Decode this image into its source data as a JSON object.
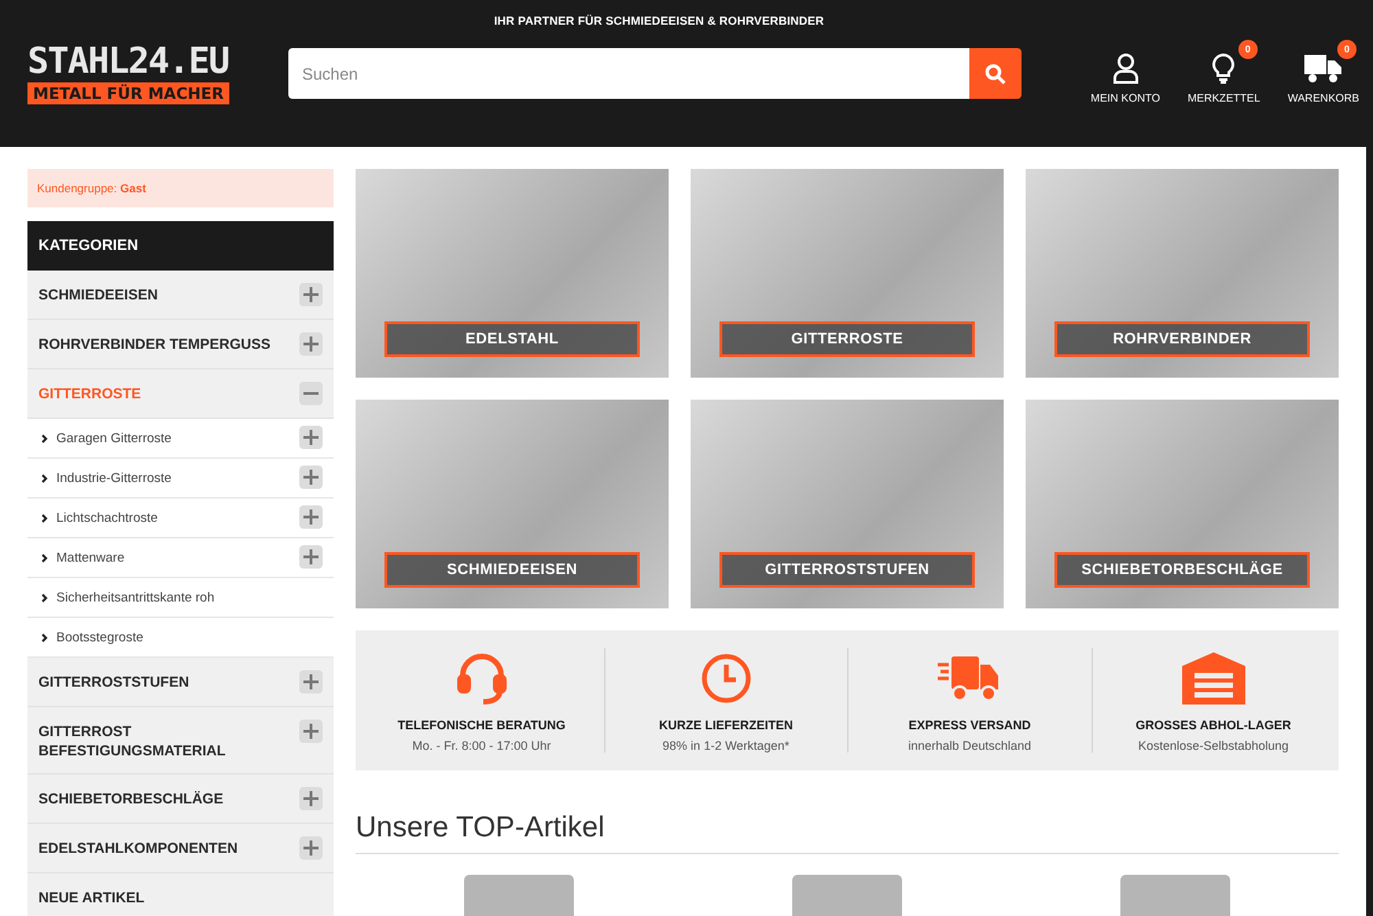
{
  "header": {
    "tagline": "IHR PARTNER FÜR SCHMIEDEEISEN & ROHRVERBINDER",
    "logo": {
      "name": "STAHL24.EU",
      "slogan": "METALL FÜR MACHER"
    },
    "search": {
      "placeholder": "Suchen"
    },
    "actions": [
      {
        "kind": "account",
        "label": "MEIN KONTO"
      },
      {
        "kind": "wishlist",
        "label": "MERKZETTEL",
        "badge": "0"
      },
      {
        "kind": "cart",
        "label": "WARENKORB",
        "badge": "0"
      }
    ]
  },
  "sidebar": {
    "customer_group": {
      "label": "Kundengruppe:",
      "value": "Gast"
    },
    "title": "KATEGORIEN",
    "items": [
      {
        "label": "SCHMIEDEEISEN",
        "expandable": true,
        "expanded": false,
        "selected": false
      },
      {
        "label": "ROHRVERBINDER TEMPERGUSS",
        "expandable": true,
        "expanded": false,
        "selected": false
      },
      {
        "label": "GITTERROSTE",
        "expandable": true,
        "expanded": true,
        "selected": true,
        "children": [
          {
            "label": "Garagen Gitterroste",
            "expandable": true
          },
          {
            "label": "Industrie-Gitterroste",
            "expandable": true
          },
          {
            "label": "Lichtschachtroste",
            "expandable": true
          },
          {
            "label": "Mattenware",
            "expandable": true
          },
          {
            "label": "Sicherheitsantrittskante roh",
            "expandable": false
          },
          {
            "label": "Bootsstegroste",
            "expandable": false
          }
        ]
      },
      {
        "label": "GITTERROSTSTUFEN",
        "expandable": true,
        "expanded": false,
        "selected": false
      },
      {
        "label": "GITTERROST BEFESTIGUNGSMATERIAL",
        "expandable": true,
        "expanded": false,
        "selected": false
      },
      {
        "label": "SCHIEBETORBESCHLÄGE",
        "expandable": true,
        "expanded": false,
        "selected": false
      },
      {
        "label": "EDELSTAHLKOMPONENTEN",
        "expandable": true,
        "expanded": false,
        "selected": false
      },
      {
        "label": "NEUE ARTIKEL",
        "expandable": false,
        "expanded": false,
        "selected": false
      }
    ]
  },
  "tiles": [
    {
      "label": "EDELSTAHL"
    },
    {
      "label": "GITTERROSTE"
    },
    {
      "label": "ROHRVERBINDER"
    },
    {
      "label": "SCHMIEDEEISEN"
    },
    {
      "label": "GITTERROSTSTUFEN"
    },
    {
      "label": "SCHIEBETORBESCHLÄGE"
    }
  ],
  "features": [
    {
      "kind": "headset",
      "title": "TELEFONISCHE BERATUNG",
      "text": "Mo. - Fr. 8:00 - 17:00 Uhr"
    },
    {
      "kind": "clock",
      "title": "KURZE LIEFERZEITEN",
      "text": "98% in 1-2 Werktagen*"
    },
    {
      "kind": "truck",
      "title": "EXPRESS VERSAND",
      "text": "innerhalb Deutschland"
    },
    {
      "kind": "warehouse",
      "title": "GROSSES ABHOL-LAGER",
      "text": "Kostenlose-Selbstabholung"
    }
  ],
  "top_articles": {
    "title": "Unsere TOP-Artikel"
  }
}
